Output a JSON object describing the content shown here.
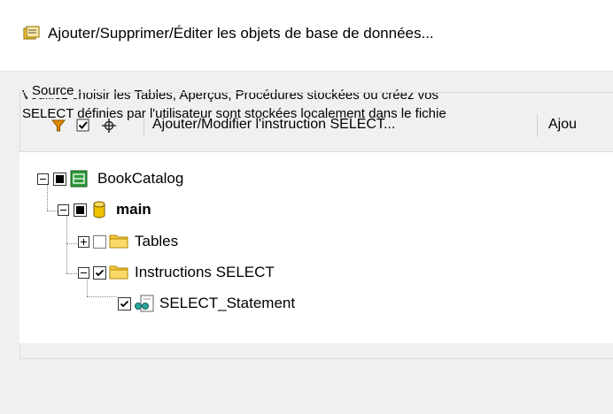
{
  "window": {
    "title": "Ajouter/Supprimer/Éditer les objets de base de données..."
  },
  "instructions": {
    "line1": "Veuillez choisir les Tables, Aperçus, Procédures stockées ou créez vos",
    "line2": "SELECT définies par l'utilisateur sont stockées localement dans le fichie"
  },
  "source_group": {
    "label": "Source"
  },
  "toolbar": {
    "filter_icon": "filter-icon",
    "check_icon": "checkmark-icon",
    "locate_icon": "crosshair-icon",
    "add_select_label": "Ajouter/Modifier l'instruction SELECT...",
    "next_label": "Ajou"
  },
  "tree": {
    "root": {
      "label": "BookCatalog",
      "expanded": true,
      "check": "partial",
      "icon": "database-connection-icon"
    },
    "schema": {
      "label": "main",
      "expanded": true,
      "check": "partial",
      "icon": "cylinder-icon"
    },
    "tables": {
      "label": "Tables",
      "expanded": false,
      "check": "unchecked",
      "icon": "folder-icon"
    },
    "select_folder": {
      "label": "Instructions SELECT",
      "expanded": true,
      "check": "checked",
      "icon": "folder-icon"
    },
    "select_statement": {
      "label": "SELECT_Statement",
      "check": "checked",
      "icon": "select-statement-icon"
    }
  },
  "colors": {
    "accent_green": "#2e9b3a",
    "filter_orange": "#e08a00",
    "folder_yellow": "#f5c542",
    "db_yellow": "#f2c300"
  }
}
